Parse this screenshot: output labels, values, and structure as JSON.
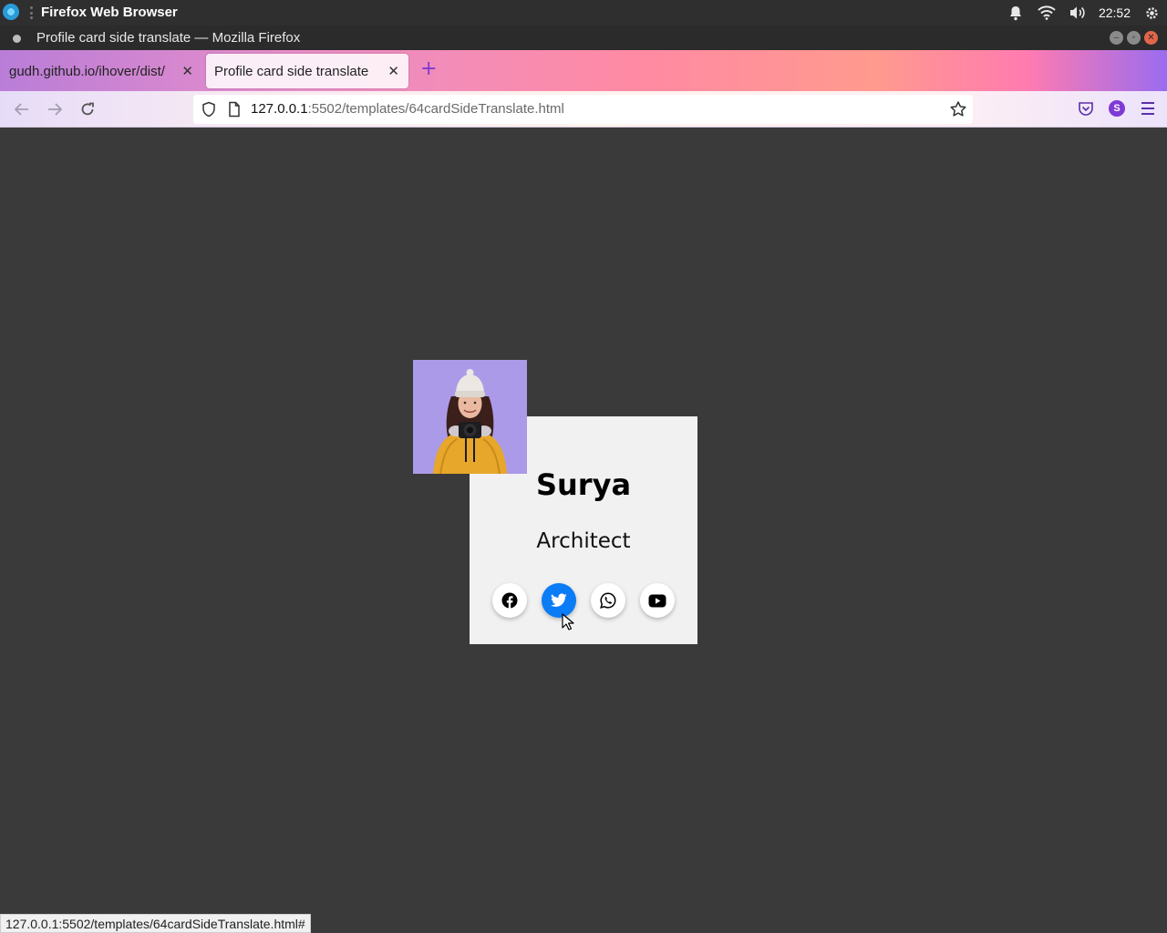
{
  "os": {
    "app_name": "Firefox Web Browser",
    "clock": "22:52"
  },
  "window": {
    "title": "Profile card side translate — Mozilla Firefox"
  },
  "tabs": [
    {
      "label": "gudh.github.io/ihover/dist/",
      "active": false
    },
    {
      "label": "Profile card side translate",
      "active": true
    }
  ],
  "navbar": {
    "url_host": "127.0.0.1",
    "url_rest": ":5502/templates/64cardSideTranslate.html",
    "account_initial": "S"
  },
  "card": {
    "name": "Surya",
    "role": "Architect",
    "socials": [
      {
        "icon": "facebook-icon",
        "active": false
      },
      {
        "icon": "twitter-icon",
        "active": true,
        "color": "#0a7cf5"
      },
      {
        "icon": "whatsapp-icon",
        "active": false
      },
      {
        "icon": "youtube-icon",
        "active": false
      }
    ]
  },
  "status_bar": {
    "text": "127.0.0.1:5502/templates/64cardSideTranslate.html#"
  },
  "colors": {
    "page_bg": "#3a3a3a",
    "card_bg": "#f1f1f1",
    "photo_bg": "#ab9ae8",
    "accent": "#0a7cf5"
  }
}
